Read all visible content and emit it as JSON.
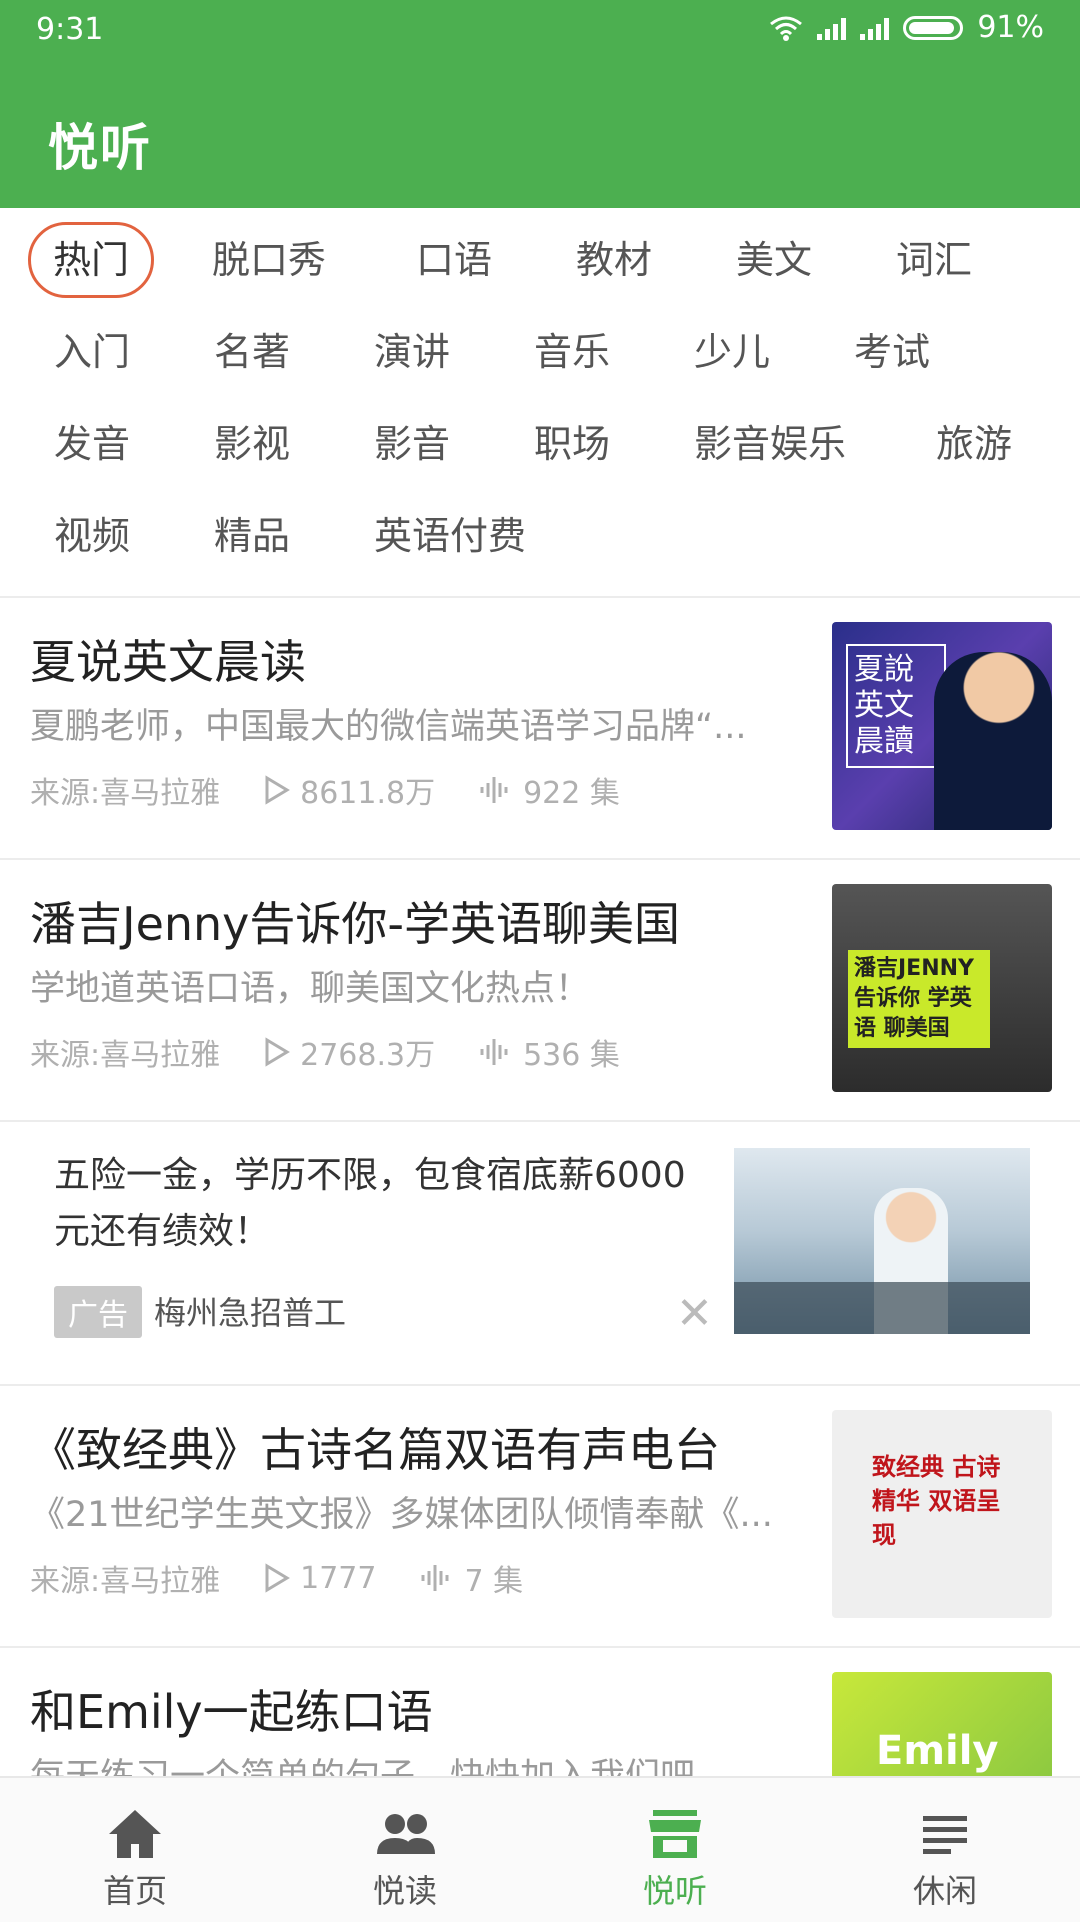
{
  "status": {
    "time": "9:31",
    "battery": "91%"
  },
  "app_title": "悦听",
  "categories": [
    [
      "热门",
      "脱口秀",
      "口语",
      "教材",
      "美文",
      "词汇"
    ],
    [
      "入门",
      "名著",
      "演讲",
      "音乐",
      "少儿",
      "考试"
    ],
    [
      "发音",
      "影视",
      "影音",
      "职场",
      "影音娱乐",
      "旅游"
    ],
    [
      "视频",
      "精品",
      "英语付费"
    ]
  ],
  "items": [
    {
      "title": "夏说英文晨读",
      "desc": "夏鹏老师，中国最大的微信端英语学习品牌“...",
      "source": "来源:喜马拉雅",
      "plays": "8611.8万",
      "episodes": "922 集",
      "thumb_text": "夏說 英文 晨讀"
    },
    {
      "title": "潘吉Jenny告诉你-学英语聊美国",
      "desc": "学地道英语口语，聊美国文化热点！",
      "source": "来源:喜马拉雅",
      "plays": "2768.3万",
      "episodes": "536 集",
      "thumb_text": "潘吉JENNY 告诉你 学英语 聊美国"
    },
    {
      "title": "《致经典》古诗名篇双语有声电台",
      "desc": "《21世纪学生英文报》多媒体团队倾情奉献《...",
      "source": "来源:喜马拉雅",
      "plays": "1777",
      "episodes": "7 集",
      "thumb_text": "致经典 古诗精华 双语呈现"
    },
    {
      "title": "和Emily一起练口语",
      "desc": "每天练习一个简单的句子，快快加入我们吧",
      "thumb_text": "Emily"
    }
  ],
  "ad": {
    "text": "五险一金，学历不限，包食宿底薪6000元还有绩效！",
    "tag": "广告",
    "source": "梅州急招普工",
    "close": "✕"
  },
  "nav": [
    {
      "label": "首页",
      "icon": "home-icon"
    },
    {
      "label": "悦读",
      "icon": "people-icon"
    },
    {
      "label": "悦听",
      "icon": "store-icon",
      "active": true
    },
    {
      "label": "休闲",
      "icon": "list-icon"
    }
  ],
  "colors": {
    "primary": "#4caf50",
    "accent": "#e2633f"
  }
}
